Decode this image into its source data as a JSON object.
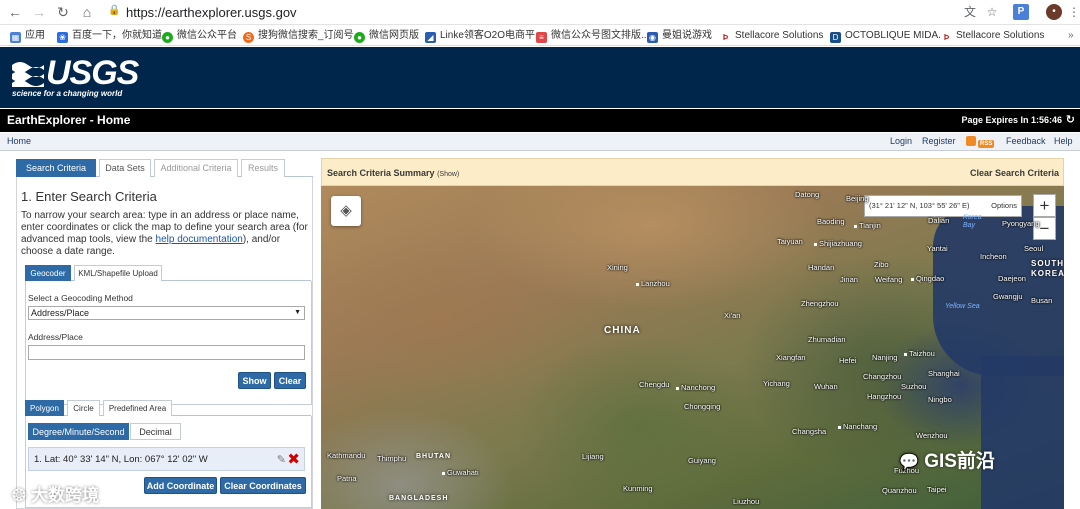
{
  "browser": {
    "url": "https://earthexplorer.usgs.gov",
    "bookmarks": [
      {
        "label": "应用",
        "color": "#4a80d8"
      },
      {
        "label": "百度一下，你就知道",
        "color": "#2b6de0"
      },
      {
        "label": "微信公众平台",
        "color": "#1aad19"
      },
      {
        "label": "搜狗微信搜索_订阅号...",
        "color": "#f06b1e"
      },
      {
        "label": "微信网页版",
        "color": "#1aad19"
      },
      {
        "label": "Linke领客O2O电商平...",
        "color": "#2a5db0"
      },
      {
        "label": "微信公众号图文排版...",
        "color": "#e04848"
      },
      {
        "label": "曼姐说游戏",
        "color": "#2a5db0"
      },
      {
        "label": "Stellacore Solutions",
        "color": "#c01818"
      },
      {
        "label": "OCTOBLIQUE MIDA...",
        "color": "#1a4e8a"
      },
      {
        "label": "Stellacore Solutions",
        "color": "#c01818"
      }
    ]
  },
  "header": {
    "logo_text": "USGS",
    "logo_tagline": "science for a changing world",
    "title": "EarthExplorer - Home",
    "expires": "Page Expires In 1:56:46"
  },
  "menu": {
    "home": "Home",
    "login": "Login",
    "register": "Register",
    "rss": "RSS",
    "feedback": "Feedback",
    "help": "Help"
  },
  "left": {
    "tabs": [
      "Search Criteria",
      "Data Sets",
      "Additional Criteria",
      "Results"
    ],
    "heading": "1. Enter Search Criteria",
    "intro_before": "To narrow your search area: type in an address or place name, enter coordinates or click the map to define your search area (for advanced map tools, view the ",
    "intro_link": "help documentation",
    "intro_after": "), and/or choose a date range.",
    "geo_tabs": [
      "Geocoder",
      "KML/Shapefile Upload"
    ],
    "method_label": "Select a Geocoding Method",
    "method_value": "Address/Place",
    "address_label": "Address/Place",
    "address_value": "",
    "show_btn": "Show",
    "clear_btn": "Clear",
    "shape_tabs": [
      "Polygon",
      "Circle",
      "Predefined Area"
    ],
    "modes": [
      "Degree/Minute/Second",
      "Decimal"
    ],
    "coordinate": "1.  Lat: 40° 33' 14\" N, Lon: 067° 12' 02\" W",
    "add_coord_btn": "Add Coordinate",
    "clear_coords_btn": "Clear Coordinates"
  },
  "map": {
    "summary_title": "Search Criteria Summary",
    "summary_show": "(Show)",
    "clear_search": "Clear Search Criteria",
    "coord_readout": "(31° 21' 12\" N, 103° 55' 26\" E)",
    "options": "Options",
    "zoom_in": "+",
    "zoom_out": "−",
    "country_china": "CHINA",
    "country_korea": "SOUTH KOREA",
    "country_bhutan": "BHUTAN",
    "country_bangladesh": "BANGLADESH",
    "sea_yellow": "Yellow Sea",
    "sea_korea_bay": "Korea Bay",
    "places": [
      "Datong",
      "Beijing",
      "Tianjin",
      "Baoding",
      "Dalian",
      "Taiyuan",
      "Shijiazhuang",
      "Yantai",
      "Xining",
      "Lanzhou",
      "Handan",
      "Zibo",
      "Jinan",
      "Weifang",
      "Qingdao",
      "Zhengzhou",
      "Xi'an",
      "Zhumadian",
      "Xiangfan",
      "Hefei",
      "Nanjing",
      "Taizhou",
      "Shanghai",
      "Changzhou",
      "Suzhou",
      "Hangzhou",
      "Ningbo",
      "Chengdu",
      "Nanchong",
      "Yichang",
      "Wuhan",
      "Chongqing",
      "Changsha",
      "Nanchang",
      "Wenzhou",
      "Lijiang",
      "Guiyang",
      "Kunming",
      "Liuzhou",
      "Fuzhou",
      "Quanzhou",
      "Taipei",
      "Kathmandu",
      "Thimphu",
      "Guwahati",
      "Patna",
      "Seoul",
      "Incheon",
      "Daejeon",
      "Gwangju",
      "Busan",
      "Pyongyang"
    ]
  },
  "watermark": {
    "left": "大数跨境",
    "right": "GIS前沿"
  }
}
